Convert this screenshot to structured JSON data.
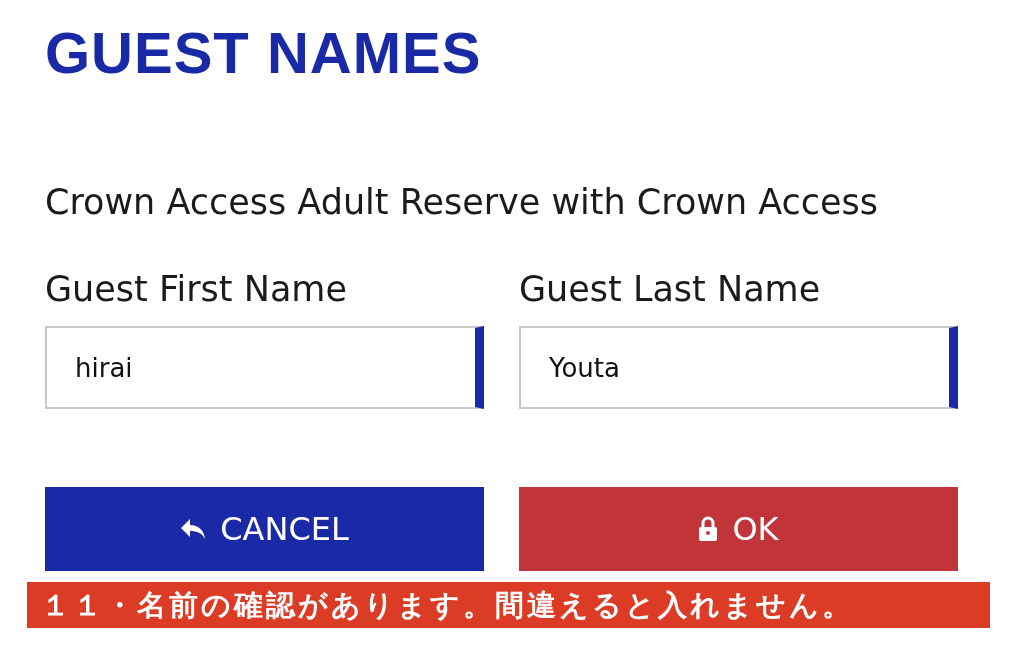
{
  "title": "GUEST NAMES",
  "ticket": "Crown Access Adult Reserve with Crown Access",
  "fields": [
    {
      "label": "Guest First Name",
      "value": "hirai"
    },
    {
      "label": "Guest Last Name",
      "value": "Youta"
    }
  ],
  "buttons": [
    {
      "kind": "cancel",
      "label": "CANCEL"
    },
    {
      "kind": "ok",
      "label": "OK"
    }
  ],
  "caption": "１１・名前の確認があります。間違えると入れません。"
}
